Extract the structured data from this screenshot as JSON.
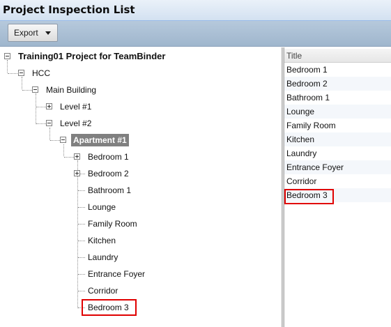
{
  "window": {
    "title": "Project Inspection List"
  },
  "toolbar": {
    "export_label": "Export"
  },
  "tree": {
    "root": "Training01 Project for TeamBinder",
    "hcc": "HCC",
    "main_building": "Main Building",
    "level1": "Level #1",
    "level2": "Level #2",
    "apartment1": "Apartment #1",
    "rooms": [
      "Bedroom 1",
      "Bedroom 2",
      "Bathroom 1",
      "Lounge",
      "Family Room",
      "Kitchen",
      "Laundry",
      "Entrance Foyer",
      "Corridor",
      "Bedroom 3"
    ]
  },
  "list": {
    "header": "Title",
    "rows": [
      "Bedroom 1",
      "Bedroom 2",
      "Bathroom 1",
      "Lounge",
      "Family Room",
      "Kitchen",
      "Laundry",
      "Entrance Foyer",
      "Corridor",
      "Bedroom 3"
    ]
  },
  "colors": {
    "highlight": "#e00000",
    "selected": "#808080",
    "toolbar": "#a9bed4"
  }
}
